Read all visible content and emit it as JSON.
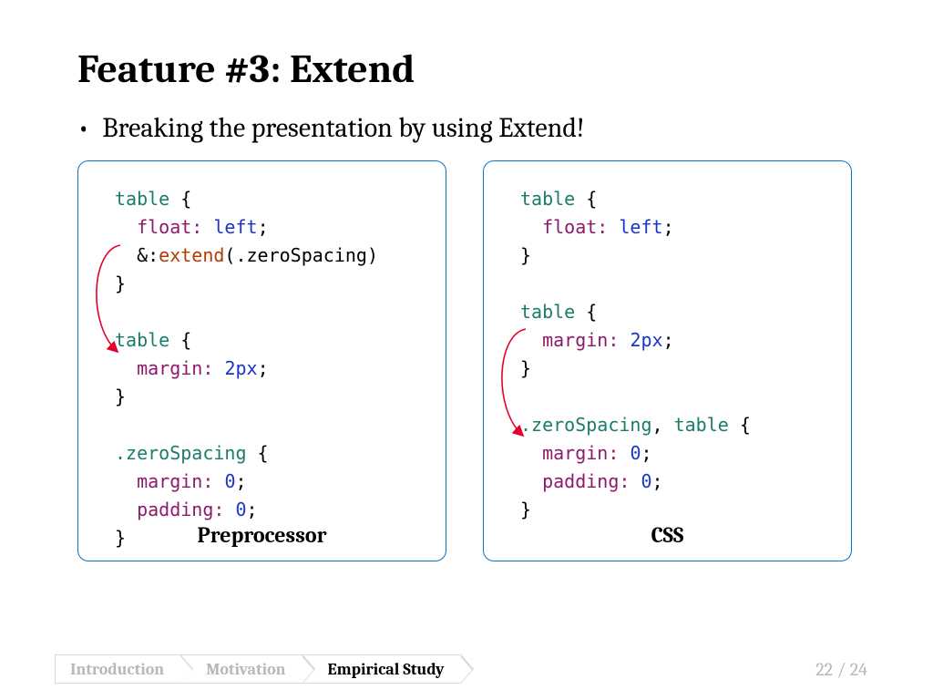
{
  "title": "Feature #3: Extend",
  "bullet": "Breaking the presentation by using Extend!",
  "left": {
    "label": "Preprocessor",
    "code": [
      [
        {
          "c": "sel",
          "t": "table"
        },
        {
          "t": " {"
        }
      ],
      [
        {
          "t": "  "
        },
        {
          "c": "prop",
          "t": "float:"
        },
        {
          "t": " "
        },
        {
          "c": "val",
          "t": "left"
        },
        {
          "t": ";"
        }
      ],
      [
        {
          "t": "  &:"
        },
        {
          "c": "ext",
          "t": "extend"
        },
        {
          "t": "(.zeroSpacing)"
        }
      ],
      [
        {
          "t": "}"
        }
      ],
      [
        {
          "t": ""
        }
      ],
      [
        {
          "c": "sel",
          "t": "table"
        },
        {
          "t": " {"
        }
      ],
      [
        {
          "t": "  "
        },
        {
          "c": "prop",
          "t": "margin:"
        },
        {
          "t": " "
        },
        {
          "c": "val",
          "t": "2px"
        },
        {
          "t": ";"
        }
      ],
      [
        {
          "t": "}"
        }
      ],
      [
        {
          "t": ""
        }
      ],
      [
        {
          "c": "sel",
          "t": ".zeroSpacing"
        },
        {
          "t": " {"
        }
      ],
      [
        {
          "t": "  "
        },
        {
          "c": "prop",
          "t": "margin:"
        },
        {
          "t": " "
        },
        {
          "c": "val",
          "t": "0"
        },
        {
          "t": ";"
        }
      ],
      [
        {
          "t": "  "
        },
        {
          "c": "prop",
          "t": "padding:"
        },
        {
          "t": " "
        },
        {
          "c": "val",
          "t": "0"
        },
        {
          "t": ";"
        }
      ],
      [
        {
          "t": "}"
        }
      ]
    ]
  },
  "right": {
    "label": "CSS",
    "code": [
      [
        {
          "c": "sel",
          "t": "table"
        },
        {
          "t": " {"
        }
      ],
      [
        {
          "t": "  "
        },
        {
          "c": "prop",
          "t": "float:"
        },
        {
          "t": " "
        },
        {
          "c": "val",
          "t": "left"
        },
        {
          "t": ";"
        }
      ],
      [
        {
          "t": "}"
        }
      ],
      [
        {
          "t": ""
        }
      ],
      [
        {
          "c": "sel",
          "t": "table"
        },
        {
          "t": " {"
        }
      ],
      [
        {
          "t": "  "
        },
        {
          "c": "prop",
          "t": "margin:"
        },
        {
          "t": " "
        },
        {
          "c": "val",
          "t": "2px"
        },
        {
          "t": ";"
        }
      ],
      [
        {
          "t": "}"
        }
      ],
      [
        {
          "t": ""
        }
      ],
      [
        {
          "c": "sel",
          "t": ".zeroSpacing"
        },
        {
          "t": ", "
        },
        {
          "c": "sel",
          "t": "table"
        },
        {
          "t": " {"
        }
      ],
      [
        {
          "t": "  "
        },
        {
          "c": "prop",
          "t": "margin:"
        },
        {
          "t": " "
        },
        {
          "c": "val",
          "t": "0"
        },
        {
          "t": ";"
        }
      ],
      [
        {
          "t": "  "
        },
        {
          "c": "prop",
          "t": "padding:"
        },
        {
          "t": " "
        },
        {
          "c": "val",
          "t": "0"
        },
        {
          "t": ";"
        }
      ],
      [
        {
          "t": "}"
        }
      ]
    ]
  },
  "nav": {
    "items": [
      "Introduction",
      "Motivation",
      "Empirical Study"
    ],
    "activeIndex": 2
  },
  "page": {
    "current": 22,
    "total": 24
  }
}
